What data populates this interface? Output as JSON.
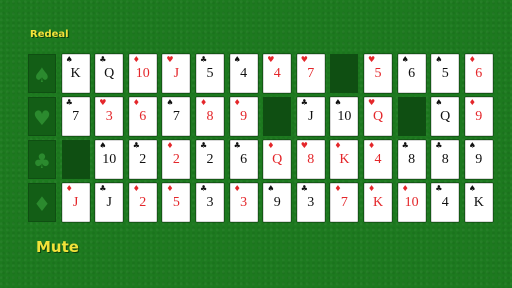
{
  "controls": {
    "redeal_label": "Redeal",
    "mute_label": "Mute"
  },
  "suit_slots": [
    "♠",
    "♥",
    "♣",
    "♦"
  ],
  "rows": [
    [
      {
        "rank": "K",
        "suit": "♠",
        "color": "black"
      },
      {
        "rank": "Q",
        "suit": "♣",
        "color": "black"
      },
      {
        "rank": "10",
        "suit": "♦",
        "color": "red"
      },
      {
        "rank": "J",
        "suit": "♥",
        "color": "red"
      },
      {
        "rank": "5",
        "suit": "♣",
        "color": "black"
      },
      {
        "rank": "4",
        "suit": "♠",
        "color": "black"
      },
      {
        "rank": "4",
        "suit": "♥",
        "color": "red"
      },
      {
        "rank": "7",
        "suit": "♥",
        "color": "red"
      },
      null,
      {
        "rank": "5",
        "suit": "♥",
        "color": "red"
      },
      {
        "rank": "6",
        "suit": "♠",
        "color": "black"
      },
      {
        "rank": "5",
        "suit": "♠",
        "color": "black"
      },
      {
        "rank": "6",
        "suit": "♦",
        "color": "red"
      }
    ],
    [
      {
        "rank": "7",
        "suit": "♣",
        "color": "black"
      },
      {
        "rank": "3",
        "suit": "♥",
        "color": "red"
      },
      {
        "rank": "6",
        "suit": "♦",
        "color": "red"
      },
      {
        "rank": "7",
        "suit": "♠",
        "color": "black"
      },
      {
        "rank": "8",
        "suit": "♦",
        "color": "red"
      },
      {
        "rank": "9",
        "suit": "♦",
        "color": "red"
      },
      null,
      {
        "rank": "J",
        "suit": "♣",
        "color": "black"
      },
      {
        "rank": "10",
        "suit": "♠",
        "color": "black"
      },
      {
        "rank": "Q",
        "suit": "♥",
        "color": "red"
      },
      null,
      {
        "rank": "Q",
        "suit": "♠",
        "color": "black"
      },
      {
        "rank": "9",
        "suit": "♦",
        "color": "red"
      }
    ],
    [
      null,
      {
        "rank": "10",
        "suit": "♠",
        "color": "black"
      },
      {
        "rank": "2",
        "suit": "♣",
        "color": "black"
      },
      {
        "rank": "2",
        "suit": "♦",
        "color": "red"
      },
      {
        "rank": "2",
        "suit": "♣",
        "color": "black"
      },
      {
        "rank": "6",
        "suit": "♣",
        "color": "black"
      },
      {
        "rank": "Q",
        "suit": "♦",
        "color": "red"
      },
      {
        "rank": "8",
        "suit": "♥",
        "color": "red"
      },
      {
        "rank": "K",
        "suit": "♦",
        "color": "red"
      },
      {
        "rank": "4",
        "suit": "♦",
        "color": "red"
      },
      {
        "rank": "8",
        "suit": "♣",
        "color": "black"
      },
      {
        "rank": "8",
        "suit": "♣",
        "color": "black"
      },
      {
        "rank": "9",
        "suit": "♠",
        "color": "black"
      }
    ],
    [
      {
        "rank": "J",
        "suit": "♦",
        "color": "red"
      },
      {
        "rank": "J",
        "suit": "♣",
        "color": "black"
      },
      {
        "rank": "2",
        "suit": "♦",
        "color": "red"
      },
      {
        "rank": "5",
        "suit": "♦",
        "color": "red"
      },
      {
        "rank": "3",
        "suit": "♣",
        "color": "black"
      },
      {
        "rank": "3",
        "suit": "♦",
        "color": "red"
      },
      {
        "rank": "9",
        "suit": "♠",
        "color": "black"
      },
      {
        "rank": "3",
        "suit": "♣",
        "color": "black"
      },
      {
        "rank": "7",
        "suit": "♦",
        "color": "red"
      },
      {
        "rank": "K",
        "suit": "♦",
        "color": "red"
      },
      {
        "rank": "10",
        "suit": "♦",
        "color": "red"
      },
      {
        "rank": "4",
        "suit": "♣",
        "color": "black"
      },
      {
        "rank": "K",
        "suit": "♠",
        "color": "black"
      }
    ]
  ]
}
